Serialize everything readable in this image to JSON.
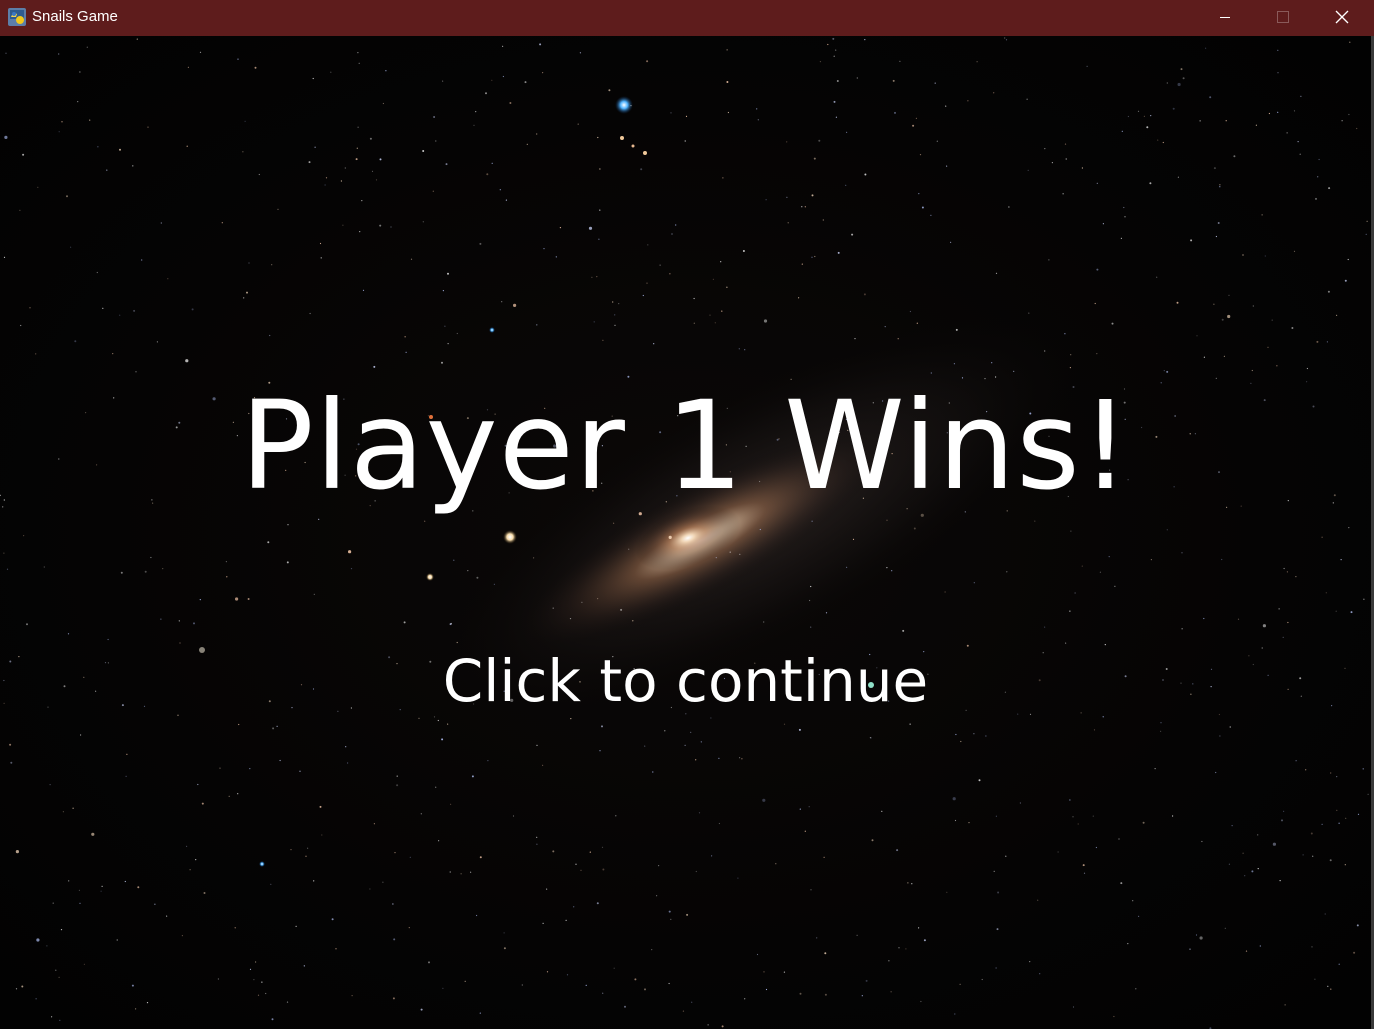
{
  "window": {
    "title": "Snails Game",
    "titlebar_color": "#5e1c1c",
    "icons": {
      "app": "python-icon",
      "minimize": "minimize-icon",
      "maximize": "maximize-icon",
      "close": "close-icon"
    }
  },
  "game": {
    "message": "Player 1 Wins!",
    "prompt": "Click to continue",
    "background": "starfield with galaxy"
  }
}
